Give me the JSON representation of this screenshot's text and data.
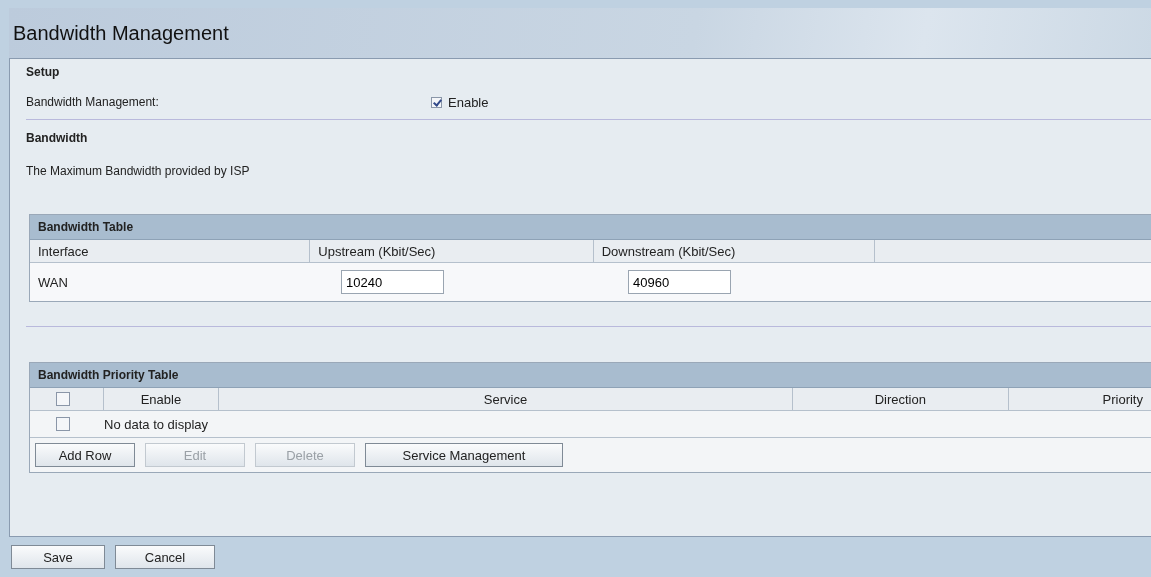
{
  "page_title": "Bandwidth Management",
  "setup": {
    "heading": "Setup",
    "label": "Bandwidth Management:",
    "checkbox": {
      "label": "Enable",
      "checked": true
    }
  },
  "bandwidth": {
    "heading": "Bandwidth",
    "description": "The Maximum Bandwidth provided by ISP"
  },
  "bandwidth_table": {
    "title": "Bandwidth Table",
    "columns": [
      "Interface",
      "Upstream (Kbit/Sec)",
      "Downstream (Kbit/Sec)"
    ],
    "rows": [
      {
        "interface": "WAN",
        "upstream": "10240",
        "downstream": "40960"
      }
    ]
  },
  "priority_table": {
    "title": "Bandwidth Priority Table",
    "header_checkbox": {
      "checked": false
    },
    "columns": [
      "Enable",
      "Service",
      "Direction",
      "Priority"
    ],
    "empty_checkbox": {
      "checked": false
    },
    "empty_message": "No data to display",
    "buttons": [
      {
        "label": "Add Row",
        "disabled": false
      },
      {
        "label": "Edit",
        "disabled": true
      },
      {
        "label": "Delete",
        "disabled": true
      },
      {
        "label": "Service Management",
        "disabled": false
      }
    ]
  },
  "footer_buttons": [
    "Save",
    "Cancel"
  ]
}
